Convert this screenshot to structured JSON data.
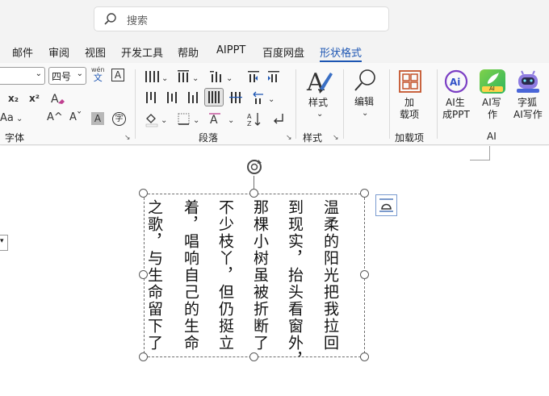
{
  "search": {
    "placeholder": "搜索"
  },
  "tabs": [
    {
      "label": "邮件"
    },
    {
      "label": "审阅"
    },
    {
      "label": "视图"
    },
    {
      "label": "开发工具"
    },
    {
      "label": "帮助"
    },
    {
      "label": "AIPPT"
    },
    {
      "label": "百度网盘"
    },
    {
      "label": "形状格式"
    }
  ],
  "ribbon": {
    "font": {
      "font_name": "",
      "font_size": "四号",
      "wen_top": "wén",
      "wen_bottom": "文",
      "boxed_a": "A",
      "subscript": "x₂",
      "superscript": "x²",
      "change_case": "Aa",
      "grow": "A^",
      "shrink": "Aˇ",
      "shade_a": "A",
      "circle_char": "字",
      "group_label": "字体"
    },
    "paragraph": {
      "group_label": "段落"
    },
    "styles": {
      "button_label": "样式",
      "group_label": "样式"
    },
    "editing": {
      "button_label": "编辑"
    },
    "addins": {
      "button_label_line1": "加",
      "button_label_line2": "载项",
      "group_label": "加载项"
    },
    "ai": {
      "ai_ppt_line1": "AI生",
      "ai_ppt_line2": "成PPT",
      "ai_write_line1": "AI写",
      "ai_write_line2": "作",
      "zihu_line1": "字狐",
      "zihu_line2": "AI写作",
      "ai_badge": "AI",
      "group_label": "AI"
    }
  },
  "document": {
    "columns": [
      "温柔的阳光把我拉回",
      "到现实，抬头看窗外，",
      "那棵小树虽被折断了",
      "不少枝丫，但仍挺立",
      "着，唱响自己的生命",
      "之歌，与生命留下了"
    ]
  },
  "colors": {
    "accent": "#1d56b3",
    "ribbon_bg": "#f9f9f9",
    "topbar_bg": "#f3f3f3",
    "addins_red": "#c4532b"
  }
}
